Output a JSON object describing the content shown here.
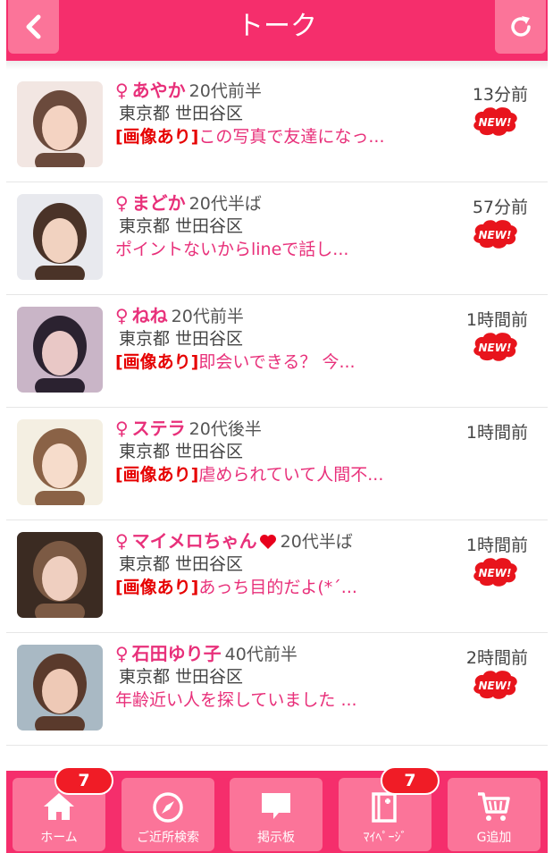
{
  "header": {
    "title": "トーク",
    "back_icon": "chevron-left-icon",
    "refresh_icon": "refresh-icon"
  },
  "talks": [
    {
      "name": "あやか",
      "age": "20代前半",
      "location": "東京都 世田谷区",
      "image_tag": "[画像あり]",
      "preview": "この写真で友達になっ...",
      "time": "13分前",
      "is_new": true,
      "heart": false,
      "avatar_colors": [
        "#f2e6e2",
        "#6b4a3c",
        "#f4d3c2"
      ]
    },
    {
      "name": "まどか",
      "age": "20代半ば",
      "location": "東京都 世田谷区",
      "image_tag": "",
      "preview": "ポイントないからlineで話し...",
      "time": "57分前",
      "is_new": true,
      "heart": false,
      "avatar_colors": [
        "#e8e9ee",
        "#4a3328",
        "#f1d2c0"
      ]
    },
    {
      "name": "ねね",
      "age": "20代前半",
      "location": "東京都 世田谷区",
      "image_tag": "[画像あり]",
      "preview": "即会いできる？ 今...",
      "time": "1時間前",
      "is_new": true,
      "heart": false,
      "avatar_colors": [
        "#c9b5c7",
        "#2b2230",
        "#e9c8c6"
      ]
    },
    {
      "name": "ステラ",
      "age": "20代後半",
      "location": "東京都 世田谷区",
      "image_tag": "[画像あり]",
      "preview": "虐められていて人間不...",
      "time": "1時間前",
      "is_new": false,
      "heart": false,
      "avatar_colors": [
        "#f4efe2",
        "#8a6246",
        "#f6dccb"
      ]
    },
    {
      "name": "マイメロちゃん",
      "age": "20代半ば",
      "location": "東京都 世田谷区",
      "image_tag": "[画像あり]",
      "preview": "あっち目的だよ(*´...",
      "time": "1時間前",
      "is_new": true,
      "heart": true,
      "avatar_colors": [
        "#3b2b22",
        "#7c5a44",
        "#efcfc0"
      ]
    },
    {
      "name": "石田ゆり子",
      "age": "40代前半",
      "location": "東京都 世田谷区",
      "image_tag": "",
      "preview": "年齢近い人を探していました ...",
      "time": "2時間前",
      "is_new": true,
      "heart": false,
      "avatar_colors": [
        "#a9b9c4",
        "#5a3a2c",
        "#eec9b6"
      ]
    }
  ],
  "new_label": "NEW!",
  "female_symbol": "♀",
  "nav": [
    {
      "label": "ホーム",
      "icon": "home-icon",
      "badge": "7"
    },
    {
      "label": "ご近所検索",
      "icon": "compass-icon",
      "badge": ""
    },
    {
      "label": "掲示板",
      "icon": "speech-bubble-icon",
      "badge": ""
    },
    {
      "label": "ﾏｲﾍﾟｰｼﾞ",
      "icon": "book-icon",
      "badge": "7"
    },
    {
      "label": "G追加",
      "icon": "cart-icon",
      "badge": ""
    }
  ],
  "colors": {
    "header": "#f52e6c",
    "button": "#fb7499",
    "name": "#e8307a",
    "image_tag": "#e60000",
    "badge": "#f01c26"
  }
}
